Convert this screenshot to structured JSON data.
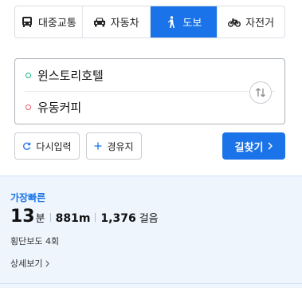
{
  "tabs": [
    {
      "label": "대중교통",
      "icon": "bus-icon",
      "active": false
    },
    {
      "label": "자동차",
      "icon": "car-icon",
      "active": false
    },
    {
      "label": "도보",
      "icon": "walk-icon",
      "active": true
    },
    {
      "label": "자전거",
      "icon": "bicycle-icon",
      "active": false
    }
  ],
  "route": {
    "start": "윈스토리호텔",
    "end": "유동커피"
  },
  "actions": {
    "reset_label": "다시입력",
    "waypoint_label": "경유지",
    "search_label": "길찾기"
  },
  "result": {
    "tag": "가장빠른",
    "minutes": "13",
    "minutes_unit": "분",
    "distance_value": "881m",
    "steps_value": "1,376",
    "steps_unit": "걸음",
    "crosswalk": "횡단보도 4회",
    "detail_label": "상세보기"
  },
  "colors": {
    "accent": "#1a73e8",
    "start_dot": "#12b886",
    "end_dot": "#e8596b",
    "result_bg": "#eef5fd"
  }
}
